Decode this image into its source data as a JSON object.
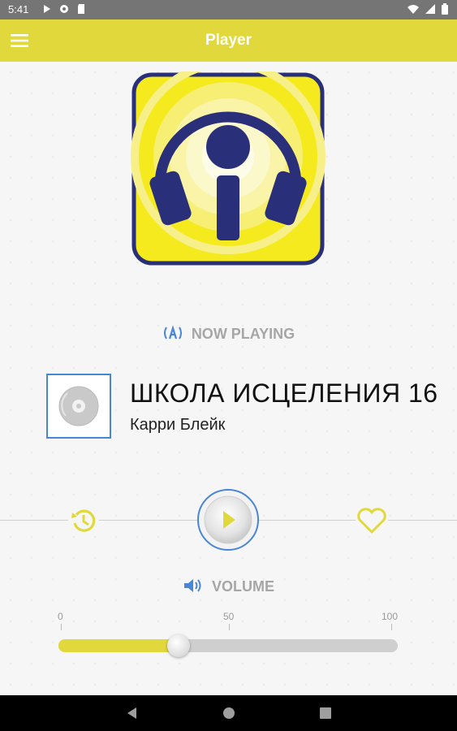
{
  "status_bar": {
    "time": "5:41",
    "left_icons": [
      "play-icon",
      "gear-icon",
      "sd-card-icon"
    ],
    "right_icons": [
      "wifi-icon",
      "signal-icon",
      "battery-icon"
    ]
  },
  "app_bar": {
    "title": "Player",
    "menu_icon": "hamburger-menu-icon"
  },
  "logo": {
    "icon": "podcast-microphone-headphones-logo",
    "colors": {
      "yellow": "#f4ea1d",
      "navy": "#2a2f7a"
    }
  },
  "now_playing": {
    "label": "NOW PLAYING",
    "icon": "broadcast-icon"
  },
  "track": {
    "thumbnail_icon": "disc-icon",
    "title": "ШКОЛА ИСЦЕЛЕНИЯ 16",
    "artist": "Карри Блейк"
  },
  "controls": {
    "history_icon": "history-icon",
    "play_icon": "play-icon",
    "favorite_icon": "heart-icon",
    "state": "paused"
  },
  "volume": {
    "label": "VOLUME",
    "icon": "speaker-icon",
    "ticks": [
      "0",
      "50",
      "100"
    ],
    "value": 35
  },
  "nav_bar": {
    "back": "back-icon",
    "home": "home-icon",
    "recents": "recents-icon"
  },
  "colors": {
    "accent": "#e1d83c",
    "blue": "#4a86d6",
    "label_gray": "#a6a6a6"
  }
}
